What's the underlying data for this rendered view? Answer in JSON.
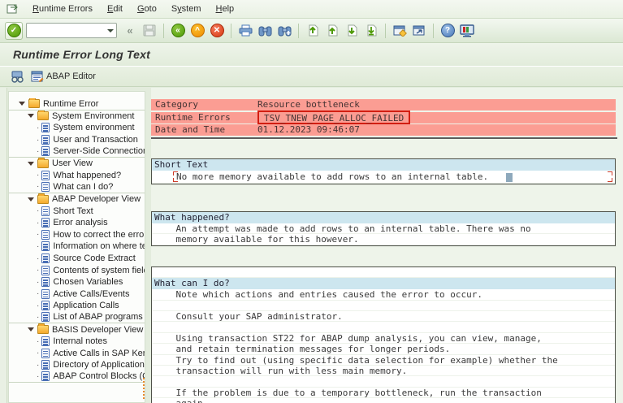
{
  "menu_bar": {
    "items": [
      {
        "label": "Runtime Errors",
        "accel_index": 0
      },
      {
        "label": "Edit",
        "accel_index": 0
      },
      {
        "label": "Goto",
        "accel_index": 0
      },
      {
        "label": "System",
        "accel_index": 1
      },
      {
        "label": "Help",
        "accel_index": 0
      }
    ]
  },
  "toolbar": {
    "command_field": {
      "value": "",
      "placeholder": ""
    },
    "icons": [
      "enter",
      "command-field",
      "collapse-field",
      "save",
      "back",
      "exit",
      "cancel",
      "print",
      "find",
      "find-next",
      "first-page",
      "previous-page",
      "next-page",
      "last-page",
      "new-session",
      "create-shortcut",
      "help",
      "customize-layout"
    ]
  },
  "title_bar": {
    "title": "Runtime Error Long Text"
  },
  "app_toolbar": {
    "buttons": [
      {
        "name": "display-dumps",
        "label": ""
      },
      {
        "name": "abap-editor",
        "label": "ABAP Editor"
      }
    ]
  },
  "tree": {
    "items": [
      {
        "label": "Runtime Error",
        "type": "folder",
        "level": 0,
        "sep": true
      },
      {
        "label": "System Environment",
        "type": "folder",
        "level": 1,
        "sep": false
      },
      {
        "label": "System environment",
        "type": "doc",
        "level": 2,
        "sep": false
      },
      {
        "label": "User and Transaction",
        "type": "doc",
        "level": 2,
        "sep": false
      },
      {
        "label": "Server-Side Connection",
        "type": "doc",
        "level": 2,
        "sep": true
      },
      {
        "label": "User View",
        "type": "folder",
        "level": 1,
        "sep": false
      },
      {
        "label": "What happened?",
        "type": "doc",
        "level": 2,
        "sep": false
      },
      {
        "label": "What can I do?",
        "type": "doc",
        "level": 2,
        "sep": true
      },
      {
        "label": "ABAP Developer View",
        "type": "folder",
        "level": 1,
        "sep": false
      },
      {
        "label": "Short Text",
        "type": "doc",
        "level": 2,
        "sep": false
      },
      {
        "label": "Error analysis",
        "type": "doc",
        "level": 2,
        "sep": false
      },
      {
        "label": "How to correct the error",
        "type": "doc",
        "level": 2,
        "sep": false
      },
      {
        "label": "Information on where term",
        "type": "doc",
        "level": 2,
        "sep": false
      },
      {
        "label": "Source Code Extract",
        "type": "doc",
        "level": 2,
        "sep": false
      },
      {
        "label": "Contents of system fields",
        "type": "doc",
        "level": 2,
        "sep": false
      },
      {
        "label": "Chosen Variables",
        "type": "doc",
        "level": 2,
        "sep": false
      },
      {
        "label": "Active Calls/Events",
        "type": "doc",
        "level": 2,
        "sep": false
      },
      {
        "label": "Application Calls",
        "type": "doc",
        "level": 2,
        "sep": false
      },
      {
        "label": "List of ABAP programs af",
        "type": "doc",
        "level": 2,
        "sep": true
      },
      {
        "label": "BASIS Developer View",
        "type": "folder",
        "level": 1,
        "sep": false
      },
      {
        "label": "Internal notes",
        "type": "doc",
        "level": 2,
        "sep": false
      },
      {
        "label": "Active Calls in SAP Kernel",
        "type": "doc",
        "level": 2,
        "sep": false
      },
      {
        "label": "Directory of Application",
        "type": "doc",
        "level": 2,
        "sep": false
      },
      {
        "label": "ABAP Control Blocks (CO",
        "type": "doc",
        "level": 2,
        "sep": true
      }
    ]
  },
  "error_header": {
    "rows": [
      {
        "label": "Category",
        "value": "Resource bottleneck",
        "boxed": false
      },
      {
        "label": "Runtime Errors",
        "value": "TSV_TNEW_PAGE_ALLOC_FAILED",
        "boxed": true
      },
      {
        "label": "Date and Time",
        "value": "01.12.2023 09:46:07",
        "boxed": false
      }
    ]
  },
  "sections": [
    {
      "title": "Short Text",
      "pre_blank": false,
      "field_markers": true,
      "cursor": true,
      "lines": [
        "No more memory available to add rows to an internal table."
      ]
    },
    {
      "title": "What happened?",
      "pre_blank": false,
      "field_markers": false,
      "cursor": false,
      "lines": [
        "An attempt was made to add rows to an internal table. There was no",
        "memory available for this however."
      ]
    },
    {
      "title": "What can I do?",
      "pre_blank": true,
      "field_markers": false,
      "cursor": false,
      "lines": [
        "Note which actions and entries caused the error to occur.",
        "",
        "Consult your SAP administrator.",
        "",
        "Using transaction ST22 for ABAP dump analysis, you can view, manage,",
        "and retain termination messages for longer periods.",
        "Try to find out (using specific data selection for example) whether the",
        "transaction will run with less main memory.",
        "",
        "If the problem is due to a temporary bottleneck, run the transaction",
        "again."
      ]
    }
  ],
  "colors": {
    "error_header_bg": "#fb9d93",
    "annotation_box": "#d21e12",
    "section_header_bg": "#cde6ef",
    "window_bg": "#e3ecdd",
    "enter_green": "#4e9a06",
    "exit_orange": "#ef8a00",
    "cancel_red": "#d83a14",
    "toolbar_icon_blue": "#4878b8"
  }
}
